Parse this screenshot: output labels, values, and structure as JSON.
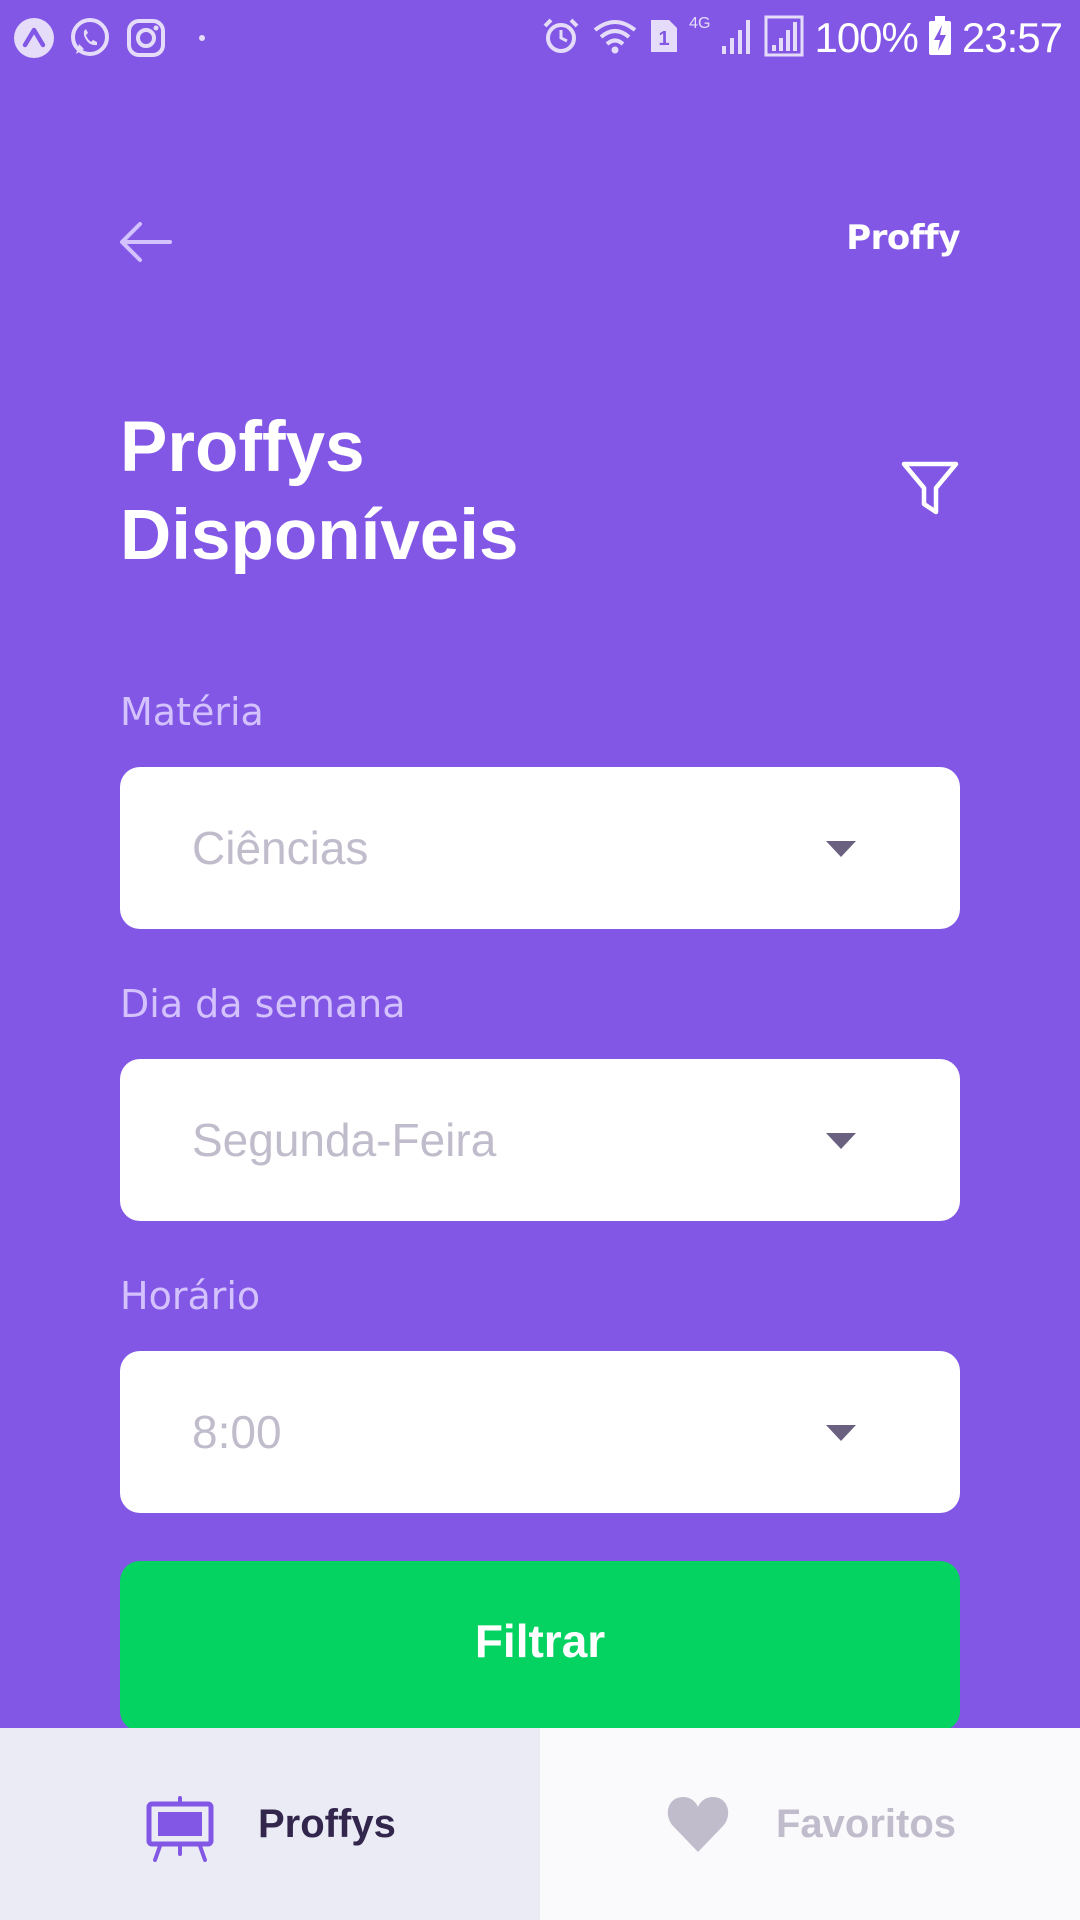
{
  "status_bar": {
    "network_type": "4G",
    "sim_slot": "1",
    "battery": "100%",
    "clock": "23:57",
    "left_icons": [
      "app-notification-icon",
      "whatsapp-icon",
      "instagram-icon",
      "dot-icon"
    ],
    "right_icons": [
      "alarm-icon",
      "wifi-icon",
      "sim-icon",
      "signal-icon",
      "signal-icon",
      "battery-charging-icon"
    ]
  },
  "header": {
    "back_icon": "arrow-left-icon",
    "logo": "Proffy"
  },
  "title": {
    "line1": "Proffys",
    "line2": "Disponíveis",
    "filter_icon": "filter-icon"
  },
  "form": {
    "subject": {
      "label": "Matéria",
      "value": "Ciências"
    },
    "week_day": {
      "label": "Dia da semana",
      "value": "Segunda-Feira"
    },
    "time": {
      "label": "Horário",
      "value": "8:00"
    },
    "submit_label": "Filtrar"
  },
  "tabs": [
    {
      "label": "Proffys",
      "icon": "easel-icon",
      "active": true
    },
    {
      "label": "Favoritos",
      "icon": "heart-icon",
      "active": false
    }
  ],
  "colors": {
    "primary": "#8257E5",
    "secondary": "#04D361",
    "label": "#D4C2FF",
    "input_text": "#C1BCCC",
    "tab_active_bg": "#EBEBF5",
    "tab_inactive_bg": "#FAFAFC",
    "tab_active_text": "#32264D"
  }
}
